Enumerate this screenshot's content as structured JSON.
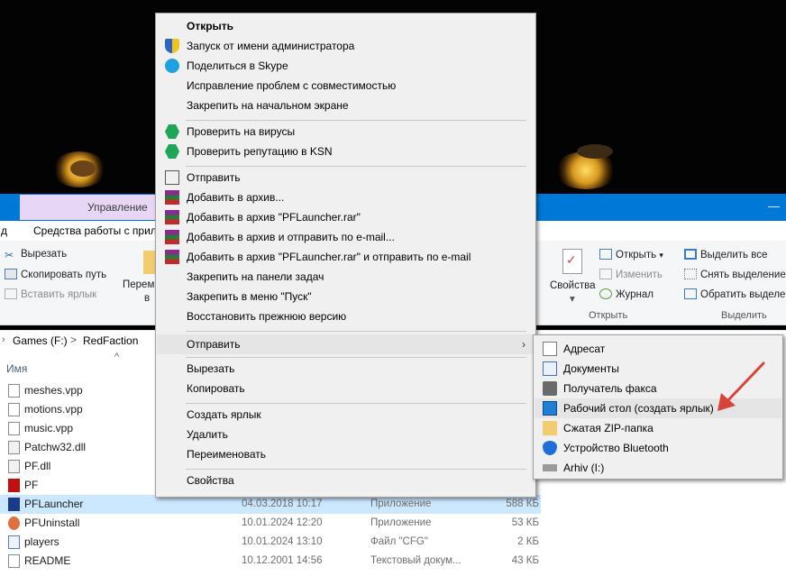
{
  "explorer": {
    "manage_tab": "Управление",
    "ribbon_tab_left": "д",
    "ribbon_tab_tools": "Средства работы с прило",
    "clipboard": {
      "cut": "Вырезать",
      "copy_path": "Скопировать путь",
      "paste_shortcut": "Вставить ярлык",
      "move_partial_1": "Перем",
      "move_partial_2": "в"
    },
    "open_group": {
      "properties": "Свойства",
      "open": "Открыть",
      "edit": "Изменить",
      "history": "Журнал",
      "label": "Открыть"
    },
    "select_group": {
      "select_all": "Выделить все",
      "select_none": "Снять выделение",
      "invert": "Обратить выделе",
      "label": "Выделить"
    },
    "breadcrumb": {
      "drive": "Games (F:)",
      "separator": ">",
      "folder": "RedFaction"
    },
    "column_name": "Имя",
    "files": [
      {
        "name": "meshes.vpp",
        "date": "",
        "type": "",
        "size": "",
        "icon": "file-icon"
      },
      {
        "name": "motions.vpp",
        "date": "",
        "type": "",
        "size": "",
        "icon": "file-icon"
      },
      {
        "name": "music.vpp",
        "date": "",
        "type": "",
        "size": "",
        "icon": "file-icon"
      },
      {
        "name": "Patchw32.dll",
        "date": "",
        "type": "",
        "size": "",
        "icon": "dll-icon"
      },
      {
        "name": "PF.dll",
        "date": "",
        "type": "",
        "size": "",
        "icon": "dll-icon"
      },
      {
        "name": "PF",
        "date": "",
        "type": "",
        "size": "",
        "icon": "pf-app-icon"
      },
      {
        "name": "PFLauncher",
        "date": "04.03.2018 10:17",
        "type": "Приложение",
        "size": "588 КБ",
        "icon": "pflauncher-icon",
        "selected": true
      },
      {
        "name": "PFUninstall",
        "date": "10.01.2024 12:20",
        "type": "Приложение",
        "size": "53 КБ",
        "icon": "uninstall-icon"
      },
      {
        "name": "players",
        "date": "10.01.2024 13:10",
        "type": "Файл \"CFG\"",
        "size": "2 КБ",
        "icon": "cfg-icon"
      },
      {
        "name": "README",
        "date": "10.12.2001 14:56",
        "type": "Текстовый докум...",
        "size": "43 КБ",
        "icon": "text-file-icon"
      }
    ]
  },
  "context_menu": {
    "items": [
      {
        "label": "Открыть",
        "bold": true
      },
      {
        "label": "Запуск от имени администратора",
        "icon": "uac-shield-icon"
      },
      {
        "label": "Поделиться в Skype",
        "icon": "skype-icon"
      },
      {
        "label": "Исправление проблем с совместимостью"
      },
      {
        "label": "Закрепить на начальном экране"
      },
      {
        "label": "Проверить на вирусы",
        "icon": "kaspersky-icon"
      },
      {
        "label": "Проверить репутацию в KSN",
        "icon": "kaspersky-icon"
      },
      {
        "label": "Отправить",
        "icon": "share-icon"
      },
      {
        "label": "Добавить в архив...",
        "icon": "winrar-icon"
      },
      {
        "label": "Добавить в архив \"PFLauncher.rar\"",
        "icon": "winrar-icon"
      },
      {
        "label": "Добавить в архив и отправить по e-mail...",
        "icon": "winrar-icon"
      },
      {
        "label": "Добавить в архив \"PFLauncher.rar\" и отправить по e-mail",
        "icon": "winrar-icon"
      },
      {
        "label": "Закрепить на панели задач"
      },
      {
        "label": "Закрепить в меню \"Пуск\""
      },
      {
        "label": "Восстановить прежнюю версию"
      },
      {
        "label": "Отправить",
        "has_submenu": true,
        "highlighted": true
      },
      {
        "label": "Вырезать"
      },
      {
        "label": "Копировать"
      },
      {
        "label": "Создать ярлык"
      },
      {
        "label": "Удалить"
      },
      {
        "label": "Переименовать"
      },
      {
        "label": "Свойства"
      }
    ],
    "submenu_arrow": "›"
  },
  "send_to_menu": {
    "items": [
      {
        "label": "Адресат",
        "icon": "mail-recipient-icon"
      },
      {
        "label": "Документы",
        "icon": "documents-icon"
      },
      {
        "label": "Получатель факса",
        "icon": "fax-icon"
      },
      {
        "label": "Рабочий стол (создать ярлык)",
        "icon": "desktop-icon",
        "highlighted": true
      },
      {
        "label": "Сжатая ZIP-папка",
        "icon": "zip-folder-icon"
      },
      {
        "label": "Устройство Bluetooth",
        "icon": "bluetooth-icon"
      },
      {
        "label": "Arhiv (I:)",
        "icon": "drive-icon"
      }
    ]
  },
  "colors": {
    "accent": "#0078d7",
    "selection": "#cce8ff",
    "menu_bg": "#f0f0f0",
    "annotation_arrow": "#d9433a"
  }
}
